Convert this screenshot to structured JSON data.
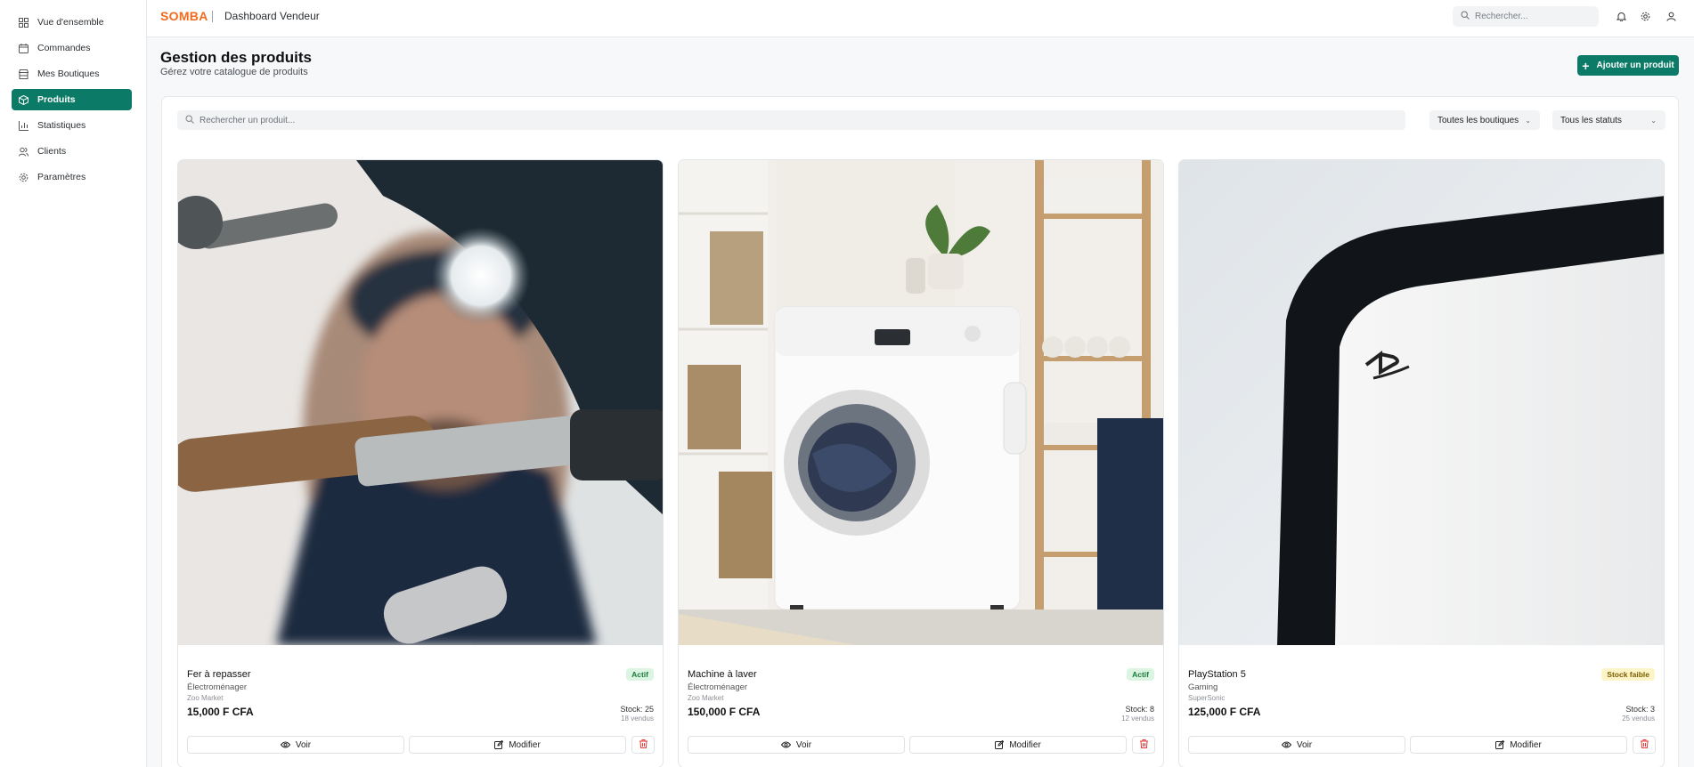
{
  "sidebar": {
    "items": [
      {
        "label": "Vue d'ensemble",
        "icon": "dashboard-icon"
      },
      {
        "label": "Commandes",
        "icon": "calendar-icon"
      },
      {
        "label": "Mes Boutiques",
        "icon": "store-icon"
      },
      {
        "label": "Produits",
        "icon": "package-icon",
        "active": true
      },
      {
        "label": "Statistiques",
        "icon": "bar-chart-icon"
      },
      {
        "label": "Clients",
        "icon": "users-icon"
      },
      {
        "label": "Paramètres",
        "icon": "gear-icon"
      }
    ]
  },
  "header": {
    "logo": "SOMBA",
    "title": "Dashboard Vendeur",
    "search_placeholder": "Rechercher..."
  },
  "page": {
    "title": "Gestion des produits",
    "subtitle": "Gérez votre catalogue de produits",
    "add_button": "Ajouter un produit"
  },
  "filters": {
    "search_placeholder": "Rechercher un produit...",
    "shop_select": "Toutes les boutiques",
    "status_select": "Tous les statuts"
  },
  "products": [
    {
      "name": "Fer à repasser",
      "category": "Électroménager",
      "shop": "Zoo Market",
      "price": "15,000 F CFA",
      "status": "Actif",
      "stock": "Stock: 25",
      "sold": "18 vendus",
      "view_label": "Voir",
      "edit_label": "Modifier"
    },
    {
      "name": "Machine à laver",
      "category": "Électroménager",
      "shop": "Zoo Market",
      "price": "150,000 F CFA",
      "status": "Actif",
      "stock": "Stock: 8",
      "sold": "12 vendus",
      "view_label": "Voir",
      "edit_label": "Modifier"
    },
    {
      "name": "PlayStation 5",
      "category": "Gaming",
      "shop": "SuperSonic",
      "price": "125,000 F CFA",
      "status": "Stock faible",
      "stock": "Stock: 3",
      "sold": "25 vendus",
      "view_label": "Voir",
      "edit_label": "Modifier"
    }
  ],
  "colors": {
    "brand": "#f26b1d",
    "accent": "#0b7a66",
    "active_badge_bg": "#dcf5e3",
    "active_badge_text": "#177a3a",
    "low_badge_bg": "#fdf5c8",
    "low_badge_text": "#7a5c00",
    "delete": "#e53935"
  }
}
